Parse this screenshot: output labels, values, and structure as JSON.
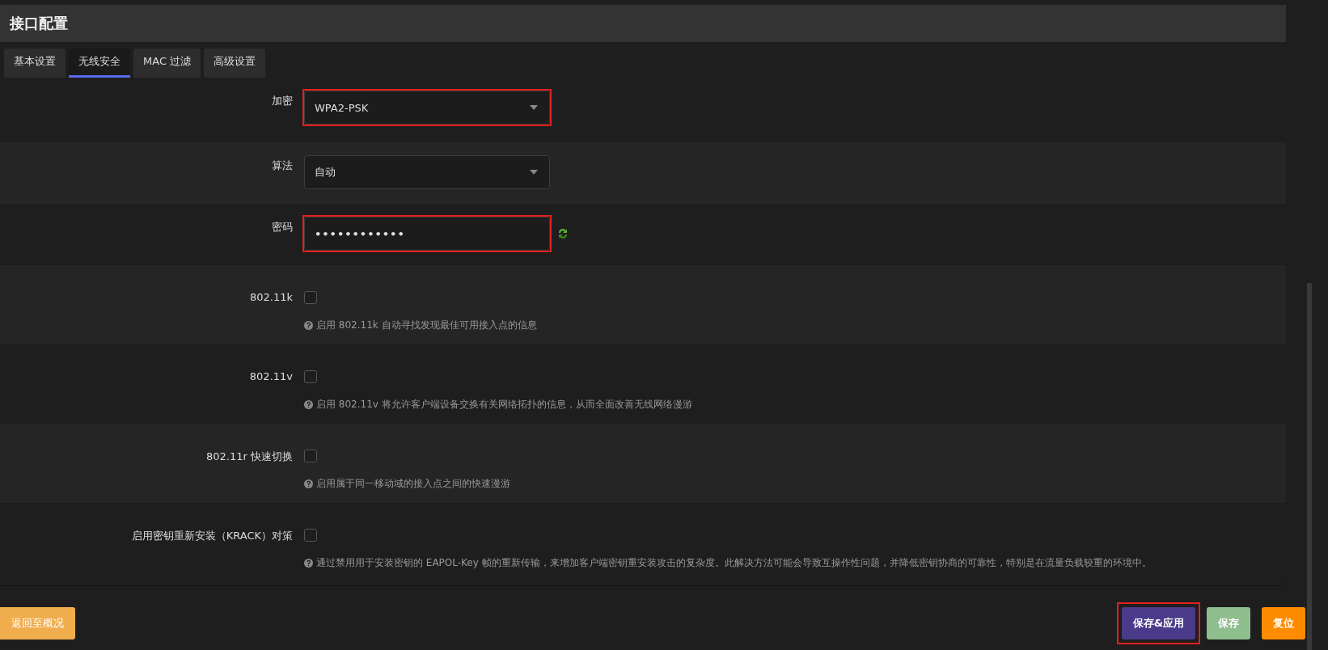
{
  "title": "接口配置",
  "tabs": [
    {
      "label": "基本设置",
      "selected": false
    },
    {
      "label": "无线安全",
      "selected": true
    },
    {
      "label": "MAC 过滤",
      "selected": false
    },
    {
      "label": "高级设置",
      "selected": false
    }
  ],
  "fields": [
    {
      "kind": "select",
      "label": "加密",
      "value": "WPA2-PSK",
      "highlighted": true
    },
    {
      "kind": "select",
      "label": "算法",
      "value": "自动",
      "highlighted": false
    },
    {
      "kind": "password",
      "label": "密码",
      "value": "••••••••••••",
      "highlighted": true
    },
    {
      "kind": "checkbox",
      "label": "802.11k",
      "checked": false,
      "help": "启用 802.11k 自动寻找发现最佳可用接入点的信息"
    },
    {
      "kind": "checkbox",
      "label": "802.11v",
      "checked": false,
      "help": "启用 802.11v 将允许客户端设备交换有关网络拓扑的信息，从而全面改善无线网络漫游"
    },
    {
      "kind": "checkbox",
      "label": "802.11r 快速切换",
      "checked": false,
      "help": "启用属于同一移动域的接入点之间的快速漫游"
    },
    {
      "kind": "checkbox",
      "label": "启用密钥重新安装（KRACK）对策",
      "checked": false,
      "help": "通过禁用用于安装密钥的 EAPOL-Key 帧的重新传输，来增加客户端密钥重安装攻击的复杂度。此解决方法可能会导致互操作性问题，并降低密钥协商的可靠性，特别是在流量负载较重的环境中。"
    }
  ],
  "back_button": "返回至概况",
  "actions": [
    {
      "kind": "apply",
      "label": "保存&应用",
      "highlighted": true
    },
    {
      "kind": "save",
      "label": "保存",
      "highlighted": false
    },
    {
      "kind": "reset",
      "label": "复位",
      "highlighted": false
    }
  ]
}
